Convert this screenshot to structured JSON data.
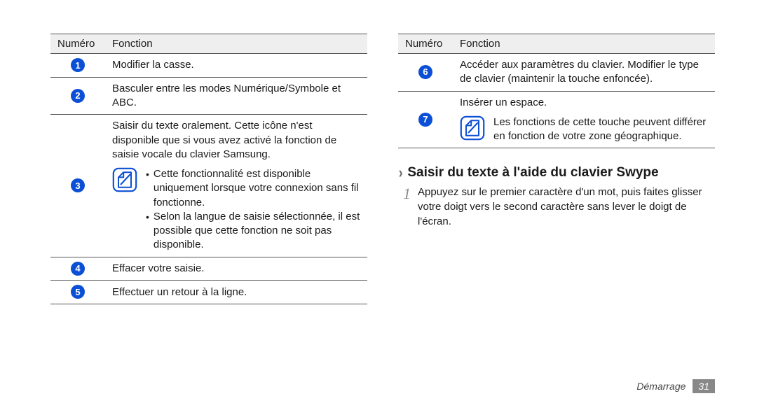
{
  "tables": {
    "left": {
      "headers": {
        "num": "Numéro",
        "func": "Fonction"
      },
      "rows": [
        {
          "num": "1",
          "func": "Modifier la casse."
        },
        {
          "num": "2",
          "func": "Basculer entre les modes Numérique/Symbole et ABC."
        },
        {
          "num": "3",
          "func": "Saisir du texte oralement. Cette icône n'est disponible que si vous avez activé la fonction de saisie vocale du clavier Samsung.",
          "bullets": [
            "Cette fonctionnalité est disponible uniquement lorsque votre connexion sans fil fonctionne.",
            "Selon la langue de saisie sélectionnée, il est possible que cette fonction ne soit pas disponible."
          ]
        },
        {
          "num": "4",
          "func": "Effacer votre saisie."
        },
        {
          "num": "5",
          "func": "Effectuer un retour à la ligne."
        }
      ]
    },
    "right": {
      "headers": {
        "num": "Numéro",
        "func": "Fonction"
      },
      "rows": [
        {
          "num": "6",
          "func": "Accéder aux paramètres du clavier. Modifier le type de clavier (maintenir la touche enfoncée)."
        },
        {
          "num": "7",
          "func": "Insérer un espace.",
          "note": "Les fonctions de cette touche peuvent différer en fonction de votre zone géographique."
        }
      ]
    }
  },
  "section": {
    "title": "Saisir du texte à l'aide du clavier Swype",
    "steps": [
      {
        "n": "1",
        "text": "Appuyez sur le premier caractère d'un mot, puis faites glisser votre doigt vers le second caractère sans lever le doigt de l'écran."
      }
    ]
  },
  "footer": {
    "section": "Démarrage",
    "page": "31"
  }
}
